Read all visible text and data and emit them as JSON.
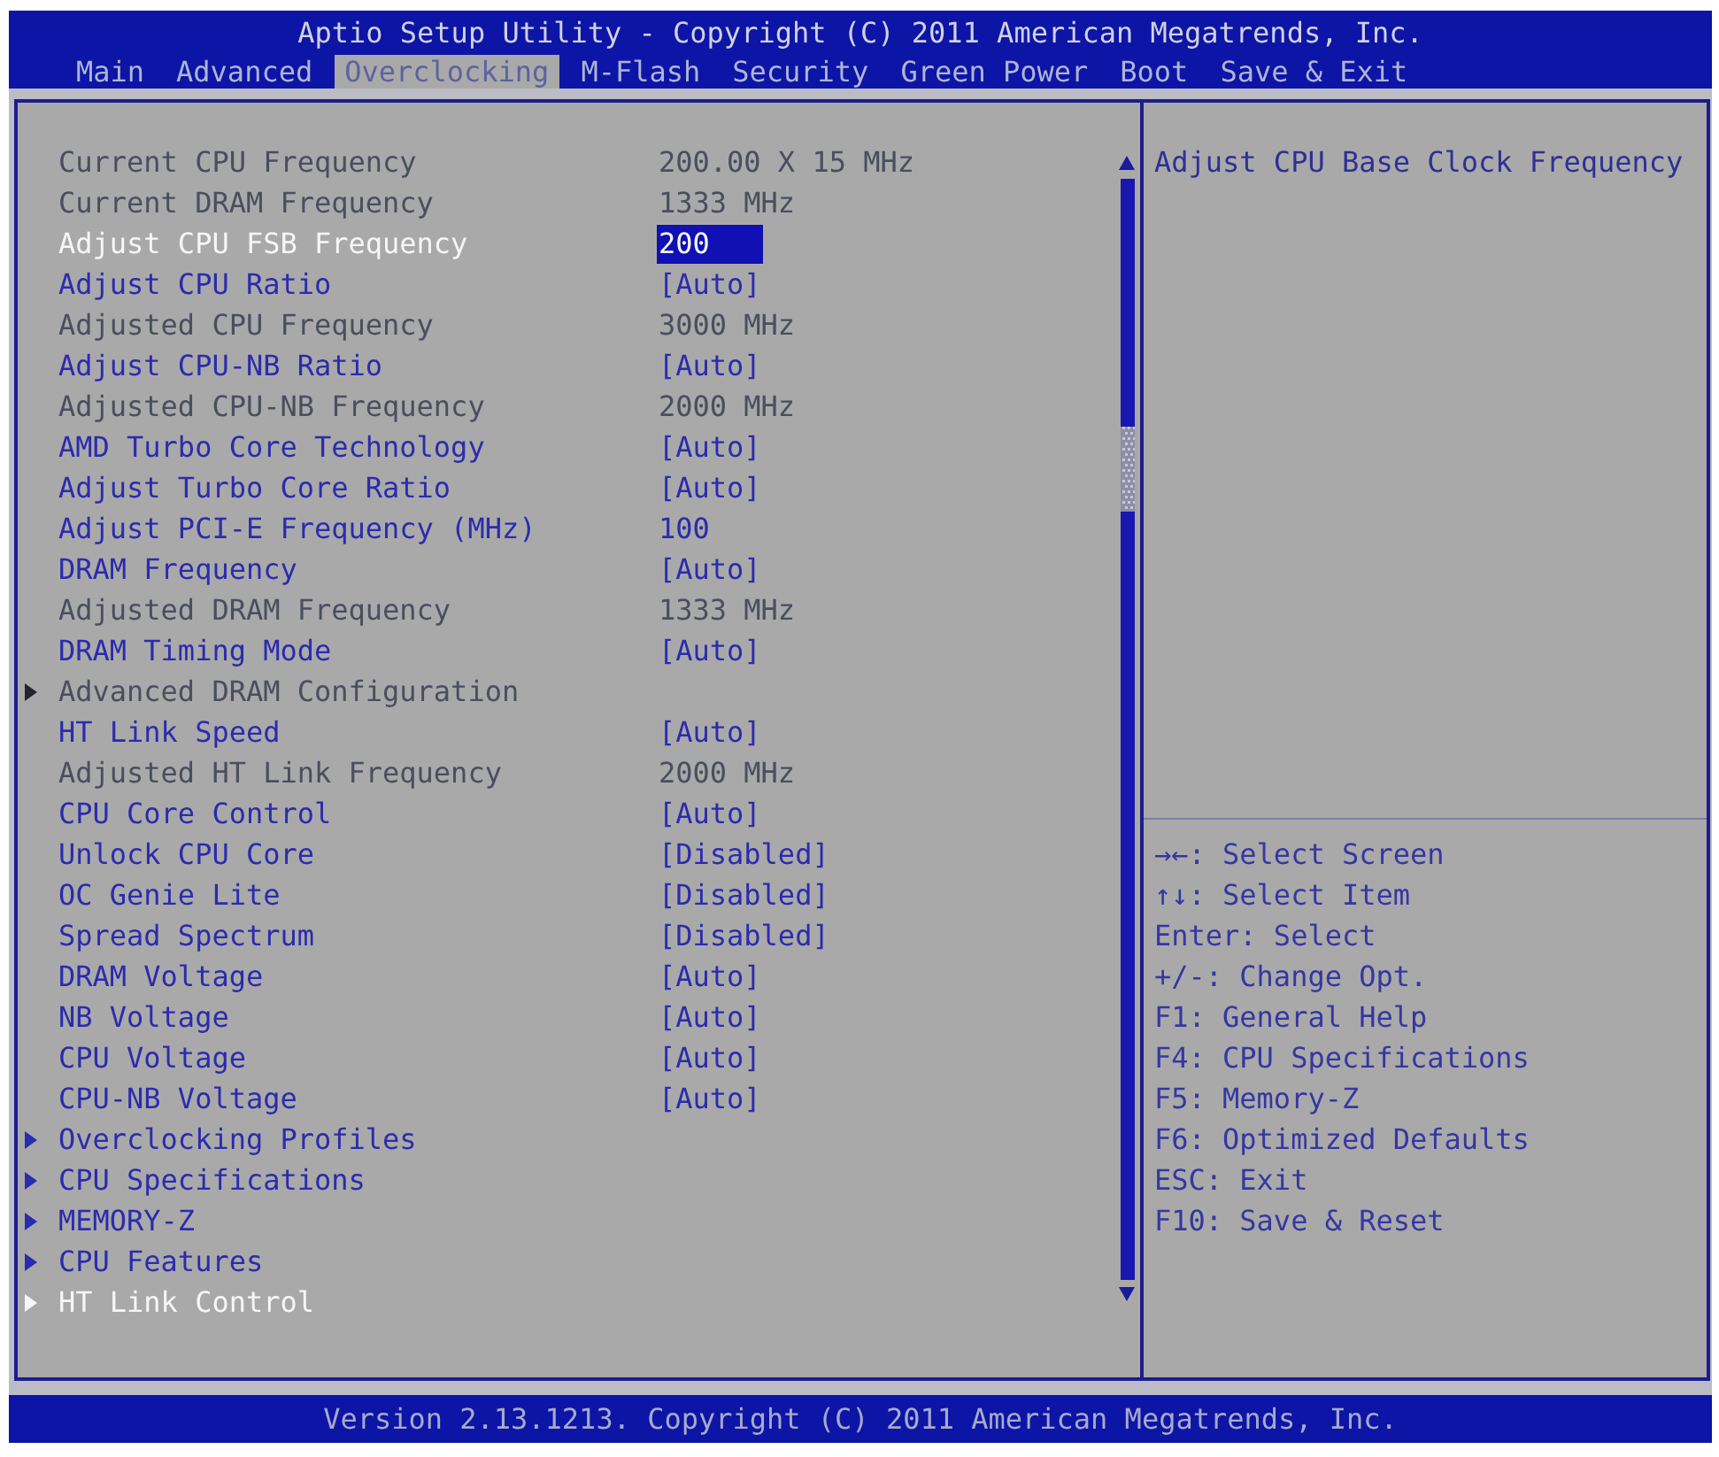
{
  "header": {
    "title": "Aptio Setup Utility - Copyright (C) 2011 American Megatrends, Inc.",
    "tabs": [
      {
        "label": "Main",
        "selected": false
      },
      {
        "label": "Advanced",
        "selected": false
      },
      {
        "label": "Overclocking",
        "selected": true
      },
      {
        "label": "M-Flash",
        "selected": false
      },
      {
        "label": "Security",
        "selected": false
      },
      {
        "label": "Green Power",
        "selected": false
      },
      {
        "label": "Boot",
        "selected": false
      },
      {
        "label": "Save & Exit",
        "selected": false
      }
    ]
  },
  "settings": [
    {
      "kind": "info",
      "label": "Current CPU Frequency",
      "value": "200.00 X 15 MHz",
      "disabled": true,
      "selected": false
    },
    {
      "kind": "info",
      "label": "Current DRAM Frequency",
      "value": "1333 MHz",
      "disabled": true,
      "selected": false
    },
    {
      "kind": "option",
      "label": "Adjust CPU FSB Frequency",
      "value": "200",
      "disabled": false,
      "selected": true
    },
    {
      "kind": "option",
      "label": "Adjust CPU Ratio",
      "value": "[Auto]",
      "disabled": false,
      "selected": false
    },
    {
      "kind": "info",
      "label": "Adjusted CPU Frequency",
      "value": "3000 MHz",
      "disabled": true,
      "selected": false
    },
    {
      "kind": "option",
      "label": "Adjust CPU-NB Ratio",
      "value": "[Auto]",
      "disabled": false,
      "selected": false
    },
    {
      "kind": "info",
      "label": "Adjusted CPU-NB Frequency",
      "value": "2000 MHz",
      "disabled": true,
      "selected": false
    },
    {
      "kind": "option",
      "label": "AMD Turbo Core Technology",
      "value": "[Auto]",
      "disabled": false,
      "selected": false
    },
    {
      "kind": "option",
      "label": "Adjust Turbo Core Ratio",
      "value": "[Auto]",
      "disabled": false,
      "selected": false
    },
    {
      "kind": "option",
      "label": "Adjust PCI-E Frequency (MHz)",
      "value": "100",
      "disabled": false,
      "selected": false
    },
    {
      "kind": "option",
      "label": "DRAM Frequency",
      "value": "[Auto]",
      "disabled": false,
      "selected": false
    },
    {
      "kind": "info",
      "label": "Adjusted DRAM Frequency",
      "value": "1333 MHz",
      "disabled": true,
      "selected": false
    },
    {
      "kind": "option",
      "label": "DRAM Timing Mode",
      "value": "[Auto]",
      "disabled": false,
      "selected": false
    },
    {
      "kind": "submenu",
      "label": "Advanced DRAM Configuration",
      "disabled": true,
      "selected": false
    },
    {
      "kind": "option",
      "label": "HT Link Speed",
      "value": "[Auto]",
      "disabled": false,
      "selected": false
    },
    {
      "kind": "info",
      "label": "Adjusted HT Link Frequency",
      "value": "2000 MHz",
      "disabled": true,
      "selected": false
    },
    {
      "kind": "option",
      "label": "CPU Core Control",
      "value": "[Auto]",
      "disabled": false,
      "selected": false
    },
    {
      "kind": "option",
      "label": "Unlock CPU Core",
      "value": "[Disabled]",
      "disabled": false,
      "selected": false
    },
    {
      "kind": "option",
      "label": "OC Genie Lite",
      "value": "[Disabled]",
      "disabled": false,
      "selected": false
    },
    {
      "kind": "option",
      "label": "Spread Spectrum",
      "value": "[Disabled]",
      "disabled": false,
      "selected": false
    },
    {
      "kind": "option",
      "label": "DRAM Voltage",
      "value": "[Auto]",
      "disabled": false,
      "selected": false
    },
    {
      "kind": "option",
      "label": "NB Voltage",
      "value": "[Auto]",
      "disabled": false,
      "selected": false
    },
    {
      "kind": "option",
      "label": "CPU Voltage",
      "value": "[Auto]",
      "disabled": false,
      "selected": false
    },
    {
      "kind": "option",
      "label": "CPU-NB Voltage",
      "value": "[Auto]",
      "disabled": false,
      "selected": false
    },
    {
      "kind": "submenu",
      "label": "Overclocking Profiles",
      "disabled": false,
      "selected": false
    },
    {
      "kind": "submenu",
      "label": "CPU Specifications",
      "disabled": false,
      "selected": false
    },
    {
      "kind": "submenu",
      "label": "MEMORY-Z",
      "disabled": false,
      "selected": false
    },
    {
      "kind": "submenu",
      "label": "CPU Features",
      "disabled": false,
      "selected": false
    },
    {
      "kind": "submenu",
      "label": "HT Link Control",
      "disabled": false,
      "selected": true
    }
  ],
  "help": {
    "text": "Adjust CPU Base Clock Frequency",
    "keys": [
      "→←: Select Screen",
      "↑↓: Select Item",
      "Enter: Select",
      "+/-: Change Opt.",
      "F1: General Help",
      "F4: CPU Specifications",
      "F5: Memory-Z",
      "F6: Optimized Defaults",
      "ESC: Exit",
      "F10: Save & Reset"
    ]
  },
  "footer": {
    "text": "Version 2.13.1213. Copyright (C) 2011 American Megatrends, Inc."
  }
}
